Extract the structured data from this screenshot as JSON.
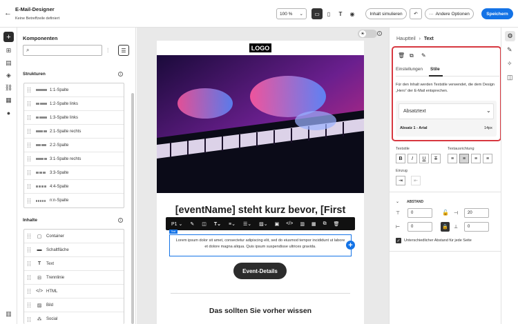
{
  "header": {
    "title": "E-Mail-Designer",
    "subtitle": "Keine Betreffzeile definiert",
    "zoom": "100 %",
    "simulate_label": "Inhalt simulieren",
    "more_options_label": "Andere Optionen",
    "save_label": "Speichern"
  },
  "components": {
    "title": "Komponenten",
    "search_placeholder": "",
    "structures_title": "Strukturen",
    "structures": [
      "1:1-Spalte",
      "1:2-Spalte links",
      "1:3-Spalte links",
      "2:1-Spalte rechts",
      "2:2-Spalte",
      "3:1-Spalte rechts",
      "3:3-Spalte",
      "4:4-Spalte",
      "n:n-Spalte"
    ],
    "contents_title": "Inhalte",
    "contents": [
      "Container",
      "Schaltfläche",
      "Text",
      "Trennlinie",
      "HTML",
      "Bild",
      "Social"
    ]
  },
  "email": {
    "logo": "LOGO",
    "headline": "[eventName] steht kurz bevor, [First",
    "toolbar_p": "P1",
    "text_tag": "Text",
    "body_text": "Lorem ipsum dolor sit amet, consectetur adipiscing elit, sed do eiusmod tempor incididunt ut labore et dolore magna aliqua. Quis ipsum suspendisse ultrices gravida.",
    "cta": "Event-Details",
    "section_title": "Das sollten Sie vorher wissen"
  },
  "props": {
    "breadcrumb_parent": "Hauptteil",
    "breadcrumb_current": "Text",
    "tab_settings": "Einstellungen",
    "tab_styles": "Stile",
    "description": "Für den Inhalt werden Textstile verwendet, die dem Design „Hero“ der E-Mail entsprechen.",
    "paragraph_select": "Absatztext",
    "paragraph_info": "Absatz 1 - Arial",
    "paragraph_size": "14px",
    "text_style_label": "Textstile",
    "text_align_label": "Textausrichtung",
    "indent_label": "Einzug",
    "spacing_title": "ABSTAND",
    "spacing_top": "0",
    "spacing_right": "20",
    "spacing_left": "0",
    "spacing_bottom": "0",
    "checkbox_label": "Unterschiedlicher Abstand für jede Seite"
  },
  "colors": {
    "accent": "#1473e6",
    "highlight": "#d7373f"
  }
}
